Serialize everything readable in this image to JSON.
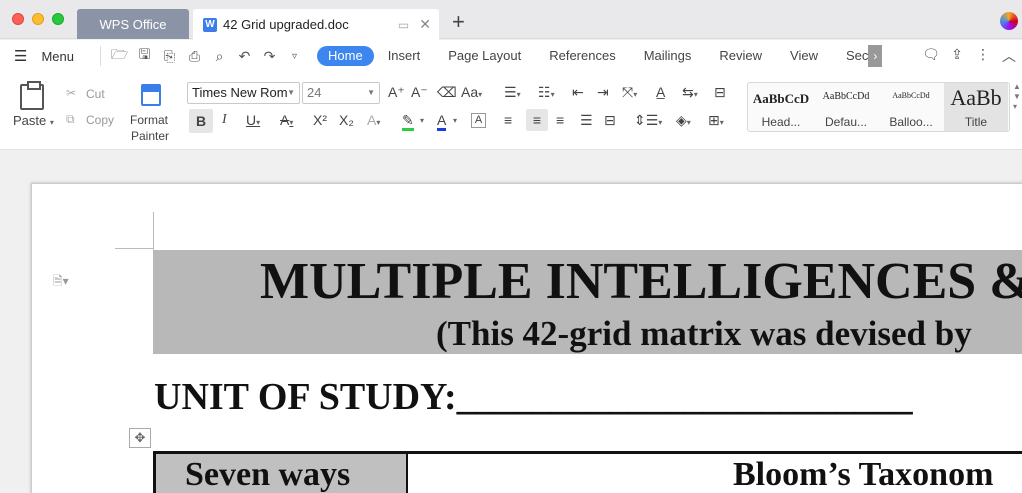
{
  "window": {
    "tabs": [
      {
        "label": "WPS Office"
      },
      {
        "label": "42 Grid upgraded.doc"
      }
    ]
  },
  "menubar": {
    "menu_label": "Menu",
    "ribbon_tabs": [
      "Home",
      "Insert",
      "Page Layout",
      "References",
      "Mailings",
      "Review",
      "View",
      "Sec"
    ]
  },
  "toolbar": {
    "paste": "Paste",
    "cut": "Cut",
    "copy": "Copy",
    "format_painter_1": "Format",
    "format_painter_2": "Painter",
    "font_name": "Times New Rom",
    "font_size": "24",
    "styles": [
      {
        "sample": "AaBbCcD",
        "name": "Head..."
      },
      {
        "sample": "AaBbCcDd",
        "name": "Defau..."
      },
      {
        "sample": "AaBbCcDd",
        "name": "Balloo..."
      },
      {
        "sample": "AaBb",
        "name": "Title"
      }
    ]
  },
  "document": {
    "heading": "MULTIPLE INTELLIGENCES &",
    "subheading": "(This 42-grid matrix was devised by",
    "unit_line": "UNIT OF STUDY:________________________",
    "table_header_1": "Seven ways",
    "table_header_2": "Bloom’s Taxonom"
  }
}
